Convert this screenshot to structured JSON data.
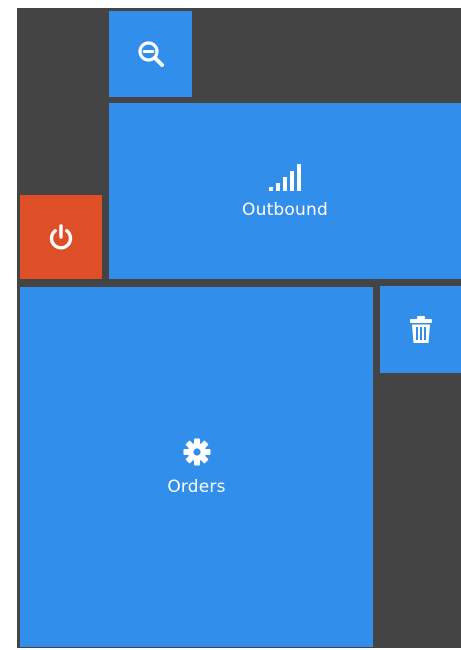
{
  "colors": {
    "background": "#444444",
    "tile_blue": "#318eea",
    "tile_orange": "#df4f27",
    "text": "#ffffff"
  },
  "tiles": {
    "zoom": {
      "icon": "zoom-out-icon"
    },
    "outbound": {
      "icon": "signal-bars-icon",
      "label": "Outbound"
    },
    "power": {
      "icon": "power-icon"
    },
    "orders": {
      "icon": "gear-icon",
      "label": "Orders"
    },
    "trash": {
      "icon": "trash-icon"
    }
  }
}
